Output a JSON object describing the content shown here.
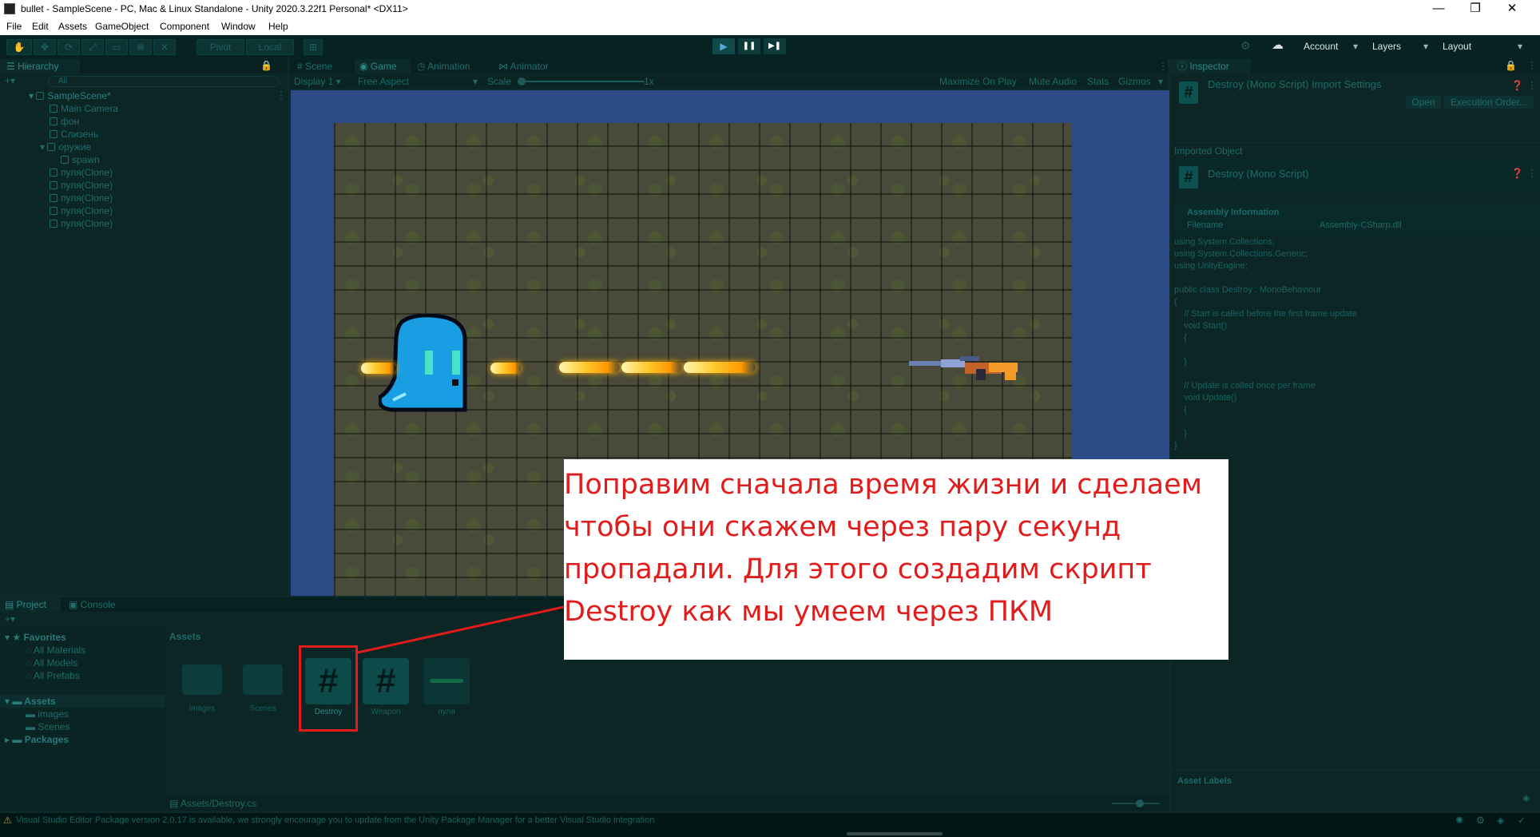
{
  "window": {
    "title": "bullet - SampleScene - PC, Mac & Linux Standalone - Unity 2020.3.22f1 Personal* <DX11>",
    "minimize": "—",
    "maximize": "❐",
    "close": "✕"
  },
  "menu": [
    "File",
    "Edit",
    "Assets",
    "GameObject",
    "Component",
    "Window",
    "Help"
  ],
  "toolbar": {
    "pivot": "Pivot",
    "local": "Local",
    "play": "▶",
    "pause": "❚❚",
    "step": "▶❚",
    "account": "Account",
    "layers": "Layers",
    "layout": "Layout"
  },
  "hierarchy": {
    "tab": "Hierarchy",
    "search": "All",
    "scene": "SampleScene*",
    "items": [
      "Main Camera",
      "фон",
      "Слизень",
      "оружие",
      "spawn",
      "пуля(Clone)",
      "пуля(Clone)",
      "пуля(Clone)",
      "пуля(Clone)",
      "пуля(Clone)"
    ]
  },
  "view_tabs": {
    "scene": "Scene",
    "game": "Game",
    "animation": "Animation",
    "animator": "Animator"
  },
  "game_bar": {
    "display": "Display 1",
    "aspect": "Free Aspect",
    "scale_label": "Scale",
    "scale_value": "1x",
    "maximize": "Maximize On Play",
    "mute": "Mute Audio",
    "stats": "Stats",
    "gizmos": "Gizmos"
  },
  "inspector": {
    "tab": "Inspector",
    "header_title": "Destroy (Mono Script) Import Settings",
    "open": "Open",
    "execution_order": "Execution Order...",
    "imported_object": "Imported Object",
    "object_title": "Destroy (Mono Script)",
    "assembly_info": "Assembly Information",
    "filename_label": "Filename",
    "filename_value": "Assembly-CSharp.dll",
    "code": "using System.Collections;\nusing System.Collections.Generic;\nusing UnityEngine;\n\npublic class Destroy : MonoBehaviour\n{\n    // Start is called before the first frame update\n    void Start()\n    {\n\n    }\n\n    // Update is called once per frame\n    void Update()\n    {\n\n    }\n}",
    "asset_labels": "Asset Labels"
  },
  "project": {
    "tab_project": "Project",
    "tab_console": "Console",
    "favorites": "Favorites",
    "fav_items": [
      "All Materials",
      "All Models",
      "All Prefabs"
    ],
    "assets_root": "Assets",
    "asset_folders": [
      "images",
      "Scenes"
    ],
    "packages": "Packages",
    "breadcrumb": "Assets",
    "assets": [
      {
        "name": "images",
        "kind": "folder"
      },
      {
        "name": "Scenes",
        "kind": "folder"
      },
      {
        "name": "Destroy",
        "kind": "script"
      },
      {
        "name": "Weapon",
        "kind": "script"
      },
      {
        "name": "пуля",
        "kind": "prefab"
      }
    ],
    "path": "Assets/Destroy.cs"
  },
  "status": {
    "message": "Visual Studio Editor Package version 2.0.17 is available, we strongly encourage you to update from the Unity Package Manager for a better Visual Studio integration"
  },
  "annotation": {
    "text": "Поправим сначала время жизни и сделаем чтобы они скажем через пару секунд пропадали. Для этого создадим скрипт Destroy как мы умеем через ПКМ",
    "color": "#e21b1b"
  }
}
